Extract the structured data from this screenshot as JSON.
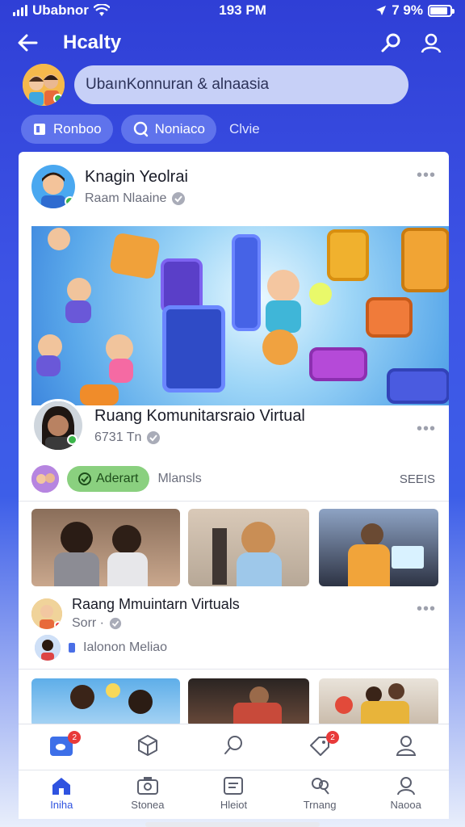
{
  "status": {
    "carrier": "Ubabnor",
    "time": "193 PM",
    "battery": "7 9%",
    "battery_level": 0.79
  },
  "header": {
    "title": "Hcalty"
  },
  "search": {
    "text": "UbaınKonnuran & alnaasia"
  },
  "chips": [
    {
      "label": "Ronboo",
      "icon": "book-icon"
    },
    {
      "label": "Noniaco",
      "icon": "chat-icon"
    },
    {
      "label": "Clvie"
    }
  ],
  "post1": {
    "name": "Knagin Yeolrai",
    "sub": "Raam Nlaaine"
  },
  "post2": {
    "name": "Ruang Komunitarsraio Virtual",
    "sub": "6731 Tn",
    "pill": "Aderart",
    "pill_caption": "Mlansls",
    "right_text": "SEEIS"
  },
  "post3": {
    "name": "Raang Mmuintarn Virtuals",
    "sub": "Sorr ·",
    "caption": "Ialonon Meliao"
  },
  "bottom_nav": {
    "top_row": [
      {
        "icon": "chat-bubble-icon",
        "badge": "2"
      },
      {
        "icon": "cube-icon"
      },
      {
        "icon": "search-icon"
      },
      {
        "icon": "tag-icon",
        "badge": "2"
      },
      {
        "icon": "profile-icon"
      }
    ],
    "bottom_row": [
      {
        "label": "Iniha",
        "icon": "home-icon"
      },
      {
        "label": "Stonea",
        "icon": "camera-icon"
      },
      {
        "label": "Hleiot",
        "icon": "document-icon"
      },
      {
        "label": "Trnang",
        "icon": "people-icon"
      },
      {
        "label": "Naooa",
        "icon": "user-icon"
      }
    ]
  },
  "colors": {
    "accent": "#2f53e0",
    "header_bg": "#3244d8",
    "online": "#3bb54a",
    "badge": "#e83a3a"
  }
}
